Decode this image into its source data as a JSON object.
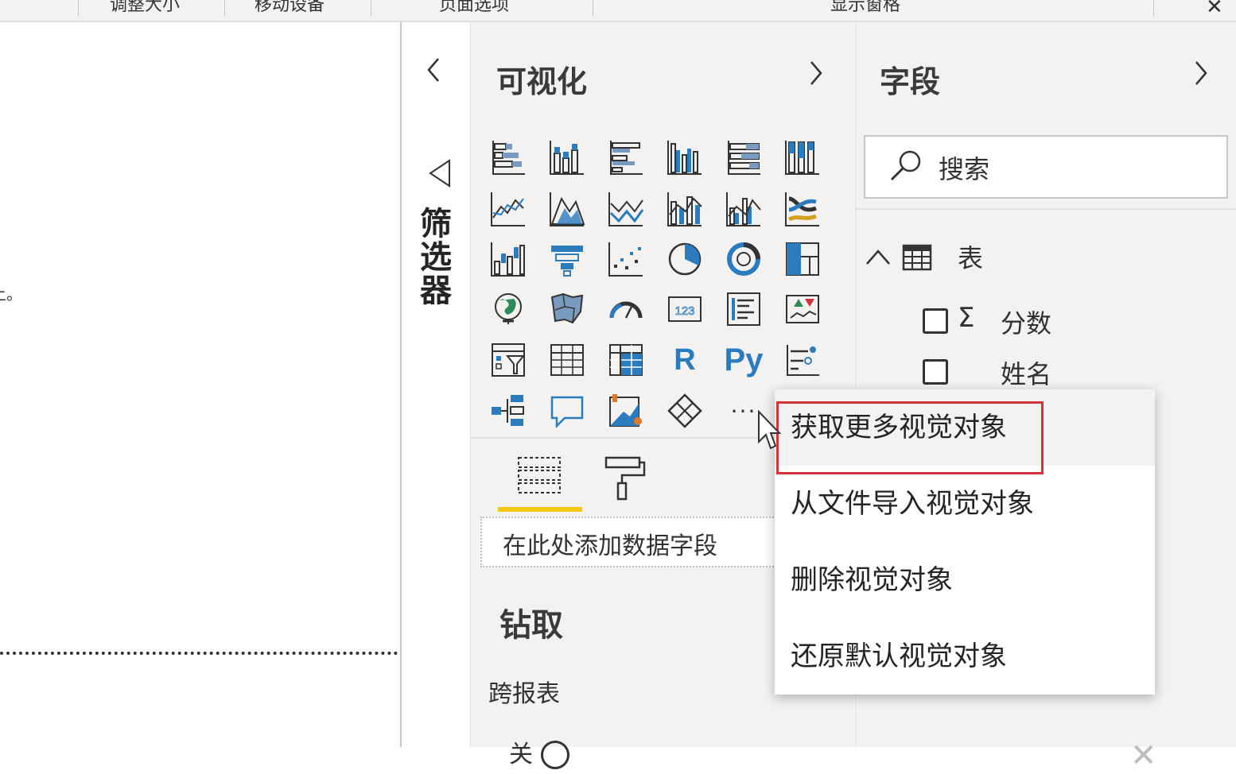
{
  "top_tabs": [
    "调整大小",
    "移动设备",
    "页面选项",
    "显示窗格"
  ],
  "canvas": {
    "text_fragment": "上。"
  },
  "filters": {
    "label": "筛选器"
  },
  "visualizations": {
    "title": "可视化",
    "icons": [
      "stacked-bar-chart-icon",
      "stacked-column-chart-icon",
      "clustered-bar-chart-icon",
      "clustered-column-chart-icon",
      "100-stacked-bar-chart-icon",
      "100-stacked-column-chart-icon",
      "line-chart-icon",
      "area-chart-icon",
      "stacked-area-chart-icon",
      "line-and-stacked-column-chart-icon",
      "line-and-clustered-column-chart-icon",
      "ribbon-chart-icon",
      "waterfall-chart-icon",
      "funnel-chart-icon",
      "scatter-chart-icon",
      "pie-chart-icon",
      "donut-chart-icon",
      "treemap-icon",
      "map-icon",
      "filled-map-icon",
      "gauge-icon",
      "card-icon",
      "multi-row-card-icon",
      "kpi-icon",
      "slicer-icon",
      "table-icon",
      "matrix-icon",
      "r-script-visual-icon",
      "python-visual-icon",
      "key-influencers-icon",
      "decomposition-tree-icon",
      "qna-icon",
      "smart-narrative-icon",
      "power-apps-icon",
      "more-visuals-icon"
    ],
    "r_label": "R",
    "py_label": "Py",
    "more_label": "···",
    "field_well_placeholder": "在此处添加数据字段",
    "drill_title": "钻取",
    "cross_report_label": "跨报表",
    "bottom_fragment": "关"
  },
  "fields": {
    "title": "字段",
    "search_placeholder": "搜索",
    "table_name": "表",
    "items": [
      {
        "name": "分数",
        "sigma": "Σ"
      },
      {
        "name": "姓名",
        "sigma": ""
      }
    ]
  },
  "context_menu": {
    "items": [
      "获取更多视觉对象",
      "从文件导入视觉对象",
      "删除视觉对象",
      "还原默认视觉对象"
    ],
    "highlighted_index": 0
  },
  "colors": {
    "accent_blue": "#2b7bbf",
    "accent_yellow": "#f2c811",
    "highlight_red": "#d13438",
    "pane_bg": "#f3f2f1"
  }
}
